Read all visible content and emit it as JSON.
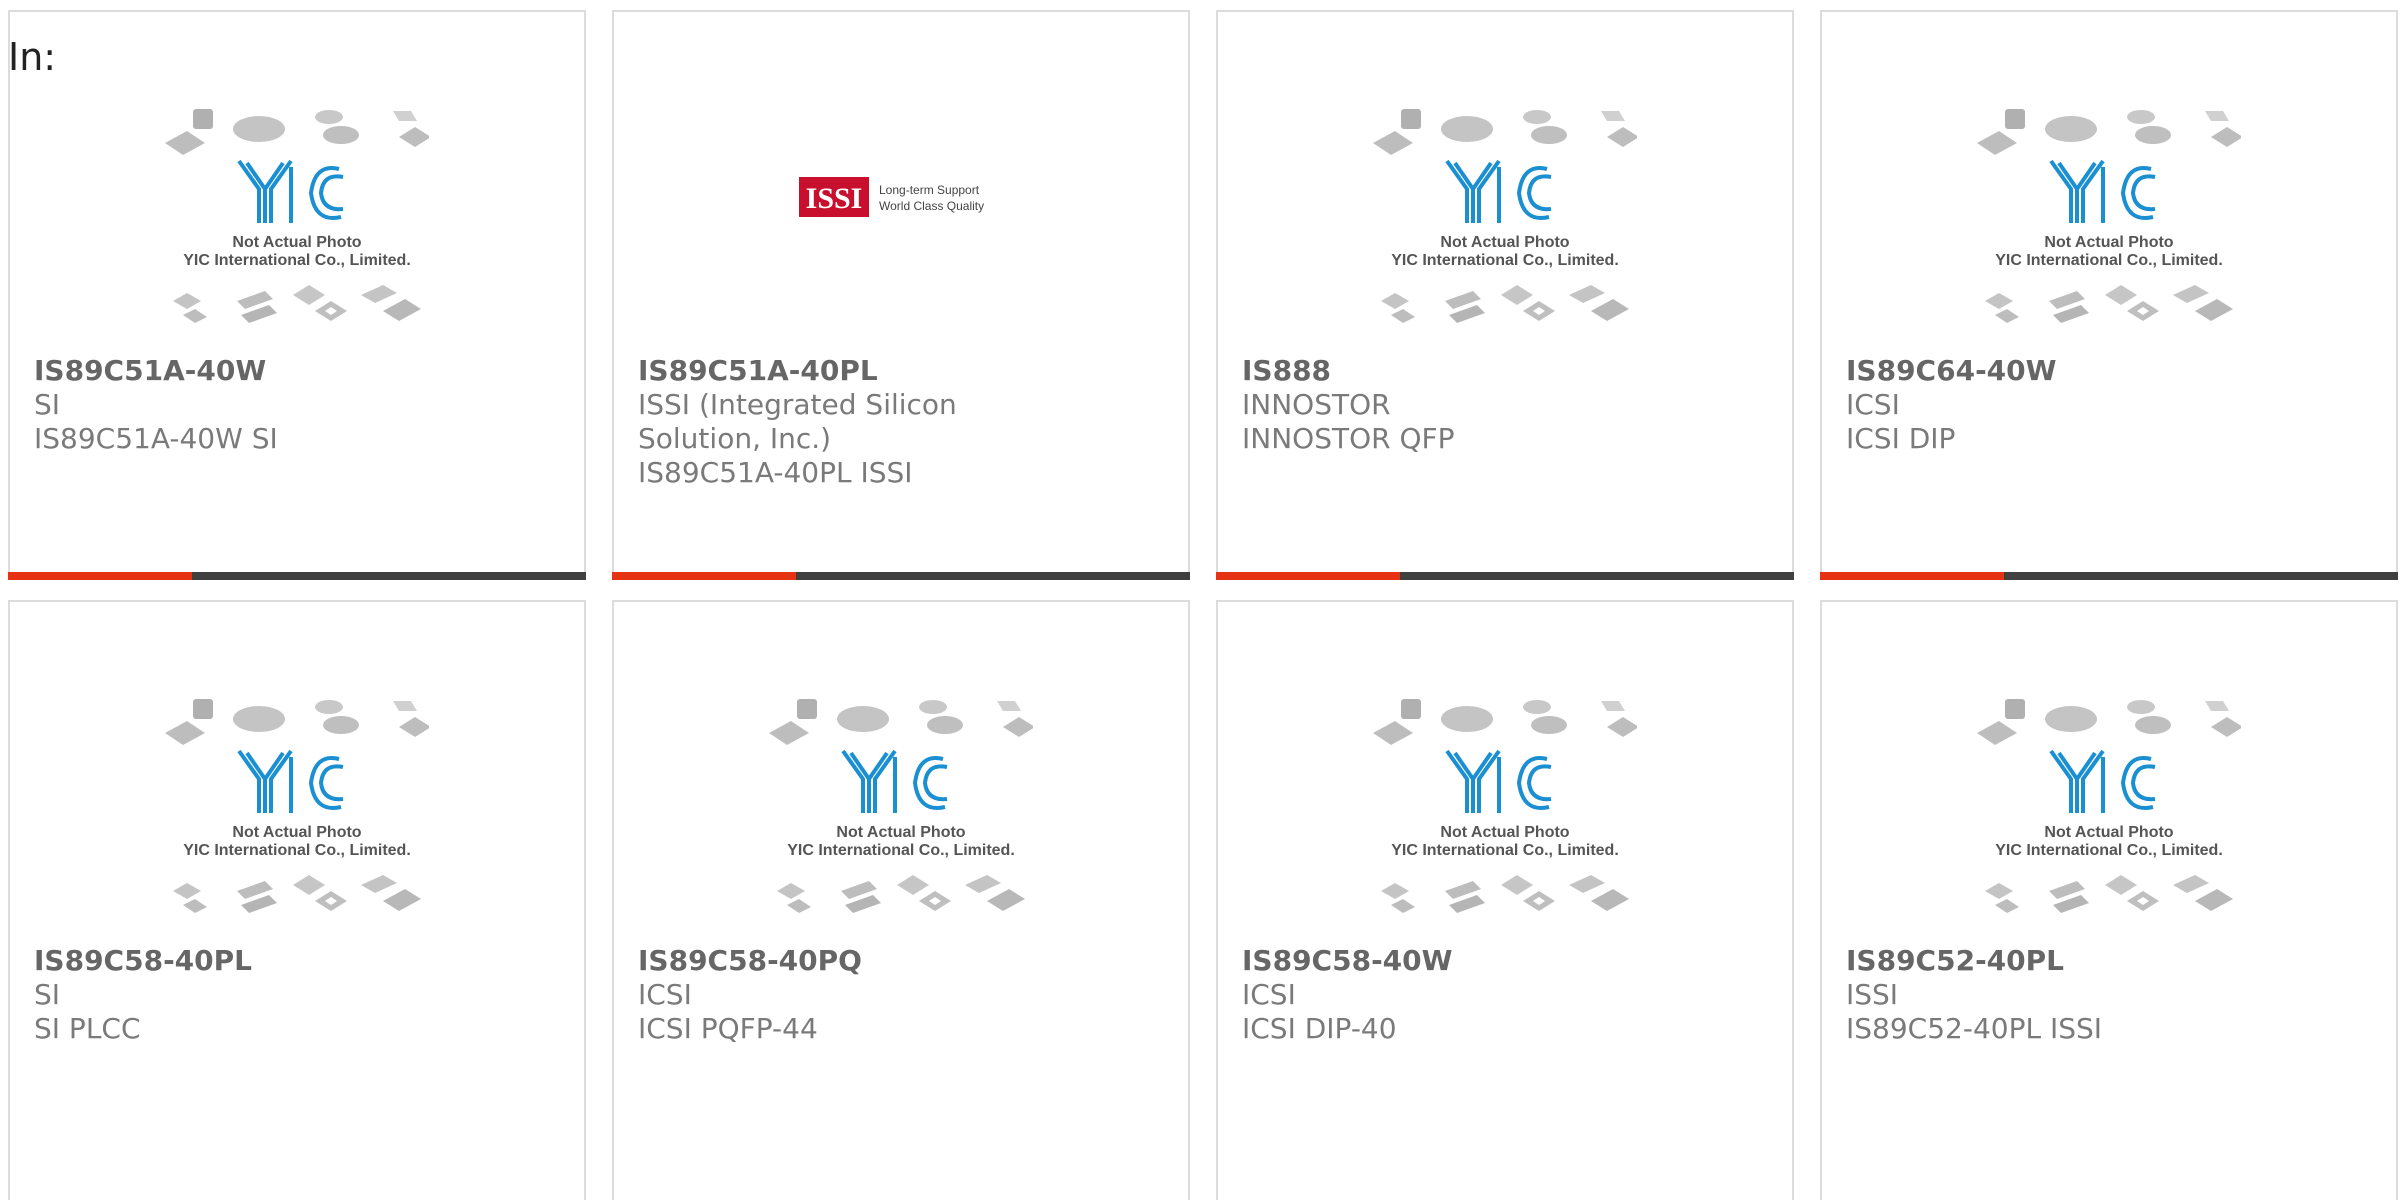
{
  "header": {
    "label": "In:"
  },
  "placeholder": {
    "line1": "Not Actual Photo",
    "line2": "YIC International Co., Limited."
  },
  "issi_logo": {
    "mark": "ISSI",
    "tag1": "Long-term Support",
    "tag2": "World Class Quality"
  },
  "colors": {
    "accent": "#e63312",
    "bar": "#404040",
    "logo_blue": "#1a8fd1",
    "issi_red": "#c8102e"
  },
  "products": [
    {
      "part": "IS89C51A-40W",
      "brand": "SI",
      "desc": "IS89C51A-40W SI"
    },
    {
      "part": "IS89C51A-40PL",
      "brand": "ISSI (Integrated Silicon Solution, Inc.)",
      "desc": "IS89C51A-40PL ISSI"
    },
    {
      "part": "IS888",
      "brand": "INNOSTOR",
      "desc": "INNOSTOR QFP"
    },
    {
      "part": "IS89C64-40W",
      "brand": "ICSI",
      "desc": "ICSI DIP"
    },
    {
      "part": "IS89C58-40PL",
      "brand": "SI",
      "desc": "SI PLCC"
    },
    {
      "part": "IS89C58-40PQ",
      "brand": "ICSI",
      "desc": "ICSI PQFP-44"
    },
    {
      "part": "IS89C58-40W",
      "brand": "ICSI",
      "desc": "ICSI DIP-40"
    },
    {
      "part": "IS89C52-40PL",
      "brand": "ISSI",
      "desc": "IS89C52-40PL ISSI"
    }
  ]
}
